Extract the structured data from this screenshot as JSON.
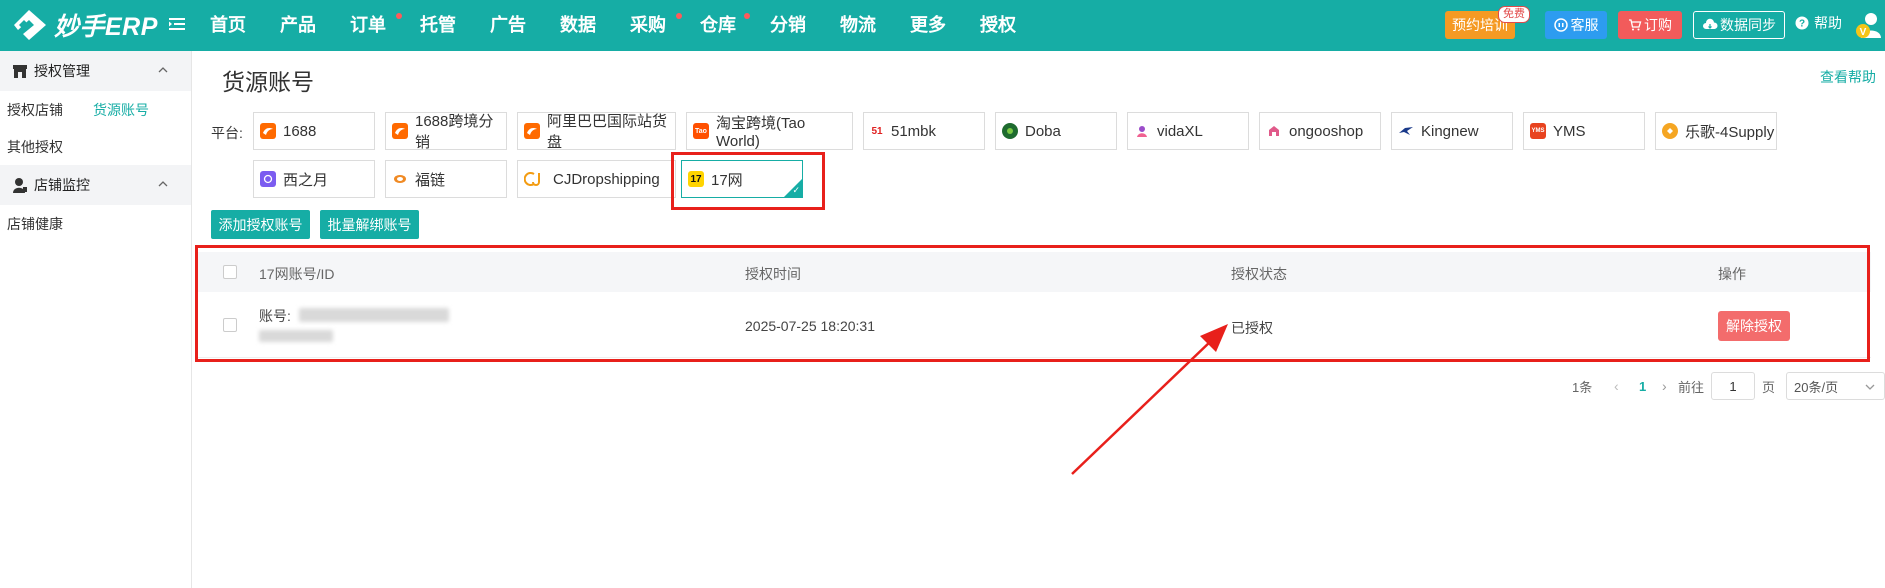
{
  "header": {
    "logo_text": "妙手ERP",
    "nav": [
      {
        "label": "首页",
        "dot": false
      },
      {
        "label": "产品",
        "dot": false
      },
      {
        "label": "订单",
        "dot": true
      },
      {
        "label": "托管",
        "dot": false
      },
      {
        "label": "广告",
        "dot": false
      },
      {
        "label": "数据",
        "dot": false
      },
      {
        "label": "采购",
        "dot": true
      },
      {
        "label": "仓库",
        "dot": true
      },
      {
        "label": "分销",
        "dot": false
      },
      {
        "label": "物流",
        "dot": false
      },
      {
        "label": "更多",
        "dot": false
      },
      {
        "label": "授权",
        "dot": false
      }
    ],
    "training_label": "预约培训",
    "free_badge": "免费",
    "service_label": "客服",
    "order_label": "订购",
    "sync_label": "数据同步",
    "help_label": "帮助"
  },
  "sidebar": {
    "group1": "授权管理",
    "row1_a": "授权店铺",
    "row1_b": "货源账号",
    "row2": "其他授权",
    "group2": "店铺监控",
    "row3": "店铺健康"
  },
  "main": {
    "title": "货源账号",
    "help_link": "查看帮助",
    "platform_label": "平台:",
    "platforms": [
      "1688",
      "1688跨境分销",
      "阿里巴巴国际站货盘",
      "淘宝跨境(Tao World)",
      "51mbk",
      "Doba",
      "vidaXL",
      "ongooshop",
      "Kingnew",
      "YMS",
      "乐歌-4Supply",
      "西之月",
      "福链",
      "CJDropshipping",
      "17网"
    ],
    "icon_texts": {
      "taobao": "Tao",
      "mbk": "51",
      "yms": "YMS",
      "w17": "17"
    },
    "add_button": "添加授权账号",
    "batch_button": "批量解绑账号",
    "table": {
      "headers": [
        "17网账号/ID",
        "授权时间",
        "授权状态",
        "操作"
      ],
      "row": {
        "account_label": "账号:",
        "time": "2025-07-25 18:20:31",
        "status": "已授权",
        "action": "解除授权"
      }
    },
    "pagination": {
      "total": "1条",
      "current_page": "1",
      "goto_label": "前往",
      "page_input": "1",
      "page_unit": "页",
      "page_size": "20条/页"
    }
  },
  "colors": {
    "accent": "#16ada5",
    "annotation": "#e8201b",
    "danger": "#f36c6c"
  }
}
